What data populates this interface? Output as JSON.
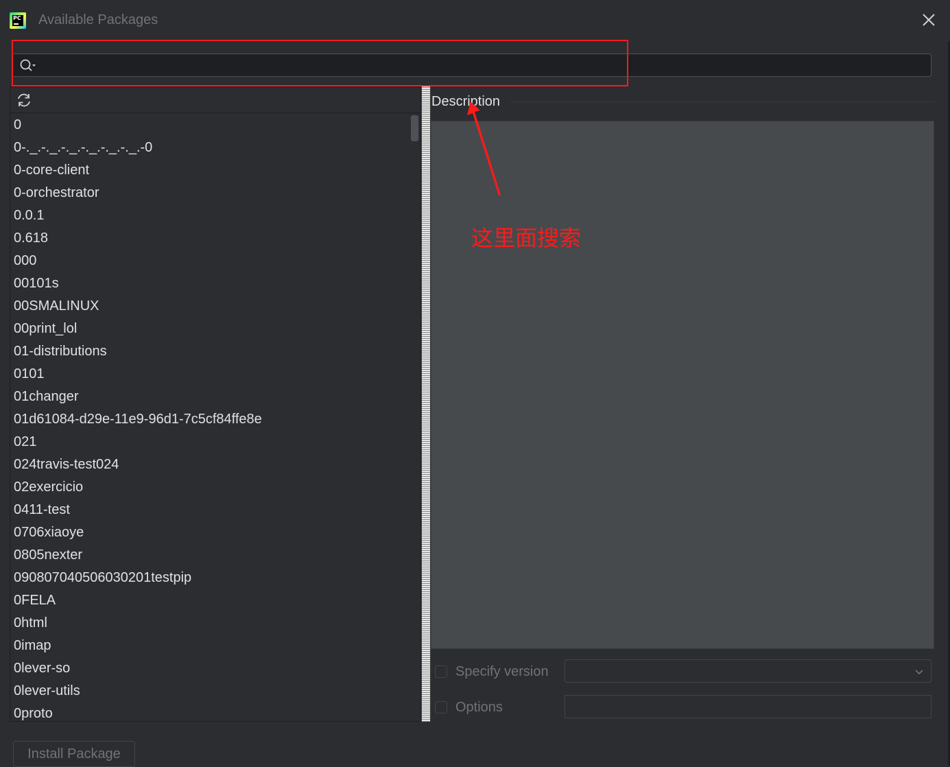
{
  "window": {
    "title": "Available Packages"
  },
  "search": {
    "value": "",
    "placeholder": ""
  },
  "packages": [
    "0",
    "0-._.-._.-._.-._.-._.-._.-0",
    "0-core-client",
    "0-orchestrator",
    "0.0.1",
    "0.618",
    "000",
    "00101s",
    "00SMALINUX",
    "00print_lol",
    "01-distributions",
    "0101",
    "01changer",
    "01d61084-d29e-11e9-96d1-7c5cf84ffe8e",
    "021",
    "024travis-test024",
    "02exercicio",
    "0411-test",
    "0706xiaoye",
    "0805nexter",
    "090807040506030201testpip",
    "0FELA",
    "0html",
    "0imap",
    "0lever-so",
    "0lever-utils",
    "0proto"
  ],
  "description": {
    "label": "Description"
  },
  "options": {
    "specify_version_label": "Specify version",
    "specify_version_checked": false,
    "version_value": "",
    "options_label": "Options",
    "options_checked": false,
    "options_value": ""
  },
  "buttons": {
    "install_label": "Install Package"
  },
  "annotation": {
    "text": "这里面搜索",
    "color": "#ff1a1a"
  },
  "theme": {
    "background": "#2b2d30",
    "text": "#dfe1e5",
    "muted": "#6f737a"
  },
  "icons": {
    "app": "pycharm-logo-icon",
    "close": "close-icon",
    "search": "search-icon",
    "refresh": "refresh-icon",
    "dropdown": "chevron-down-icon"
  }
}
